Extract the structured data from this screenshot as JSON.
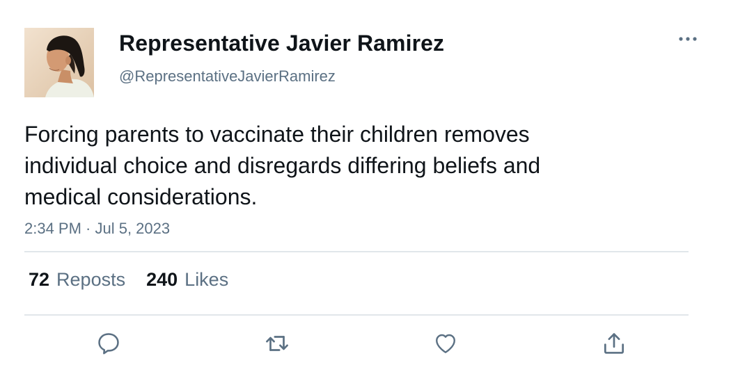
{
  "author": {
    "display_name": "Representative Javier Ramirez",
    "handle": "@RepresentativeJavierRamirez"
  },
  "tweet": {
    "text": "Forcing parents to vaccinate their children removes\nindividual choice and disregards differing beliefs and\nmedical considerations.",
    "timestamp": "2:34 PM · Jul 5, 2023"
  },
  "stats": {
    "reposts_count": "72",
    "reposts_label": "Reposts",
    "likes_count": "240",
    "likes_label": "Likes"
  },
  "actions": {
    "reply_icon": "reply-icon",
    "repost_icon": "repost-icon",
    "like_icon": "heart-icon",
    "share_icon": "share-icon"
  },
  "menu": {
    "more_icon": "ellipsis-icon"
  },
  "colors": {
    "primary_text": "#0f1419",
    "secondary_text": "#5b7083",
    "divider": "#e1e6ea",
    "icon": "#5b7083"
  }
}
